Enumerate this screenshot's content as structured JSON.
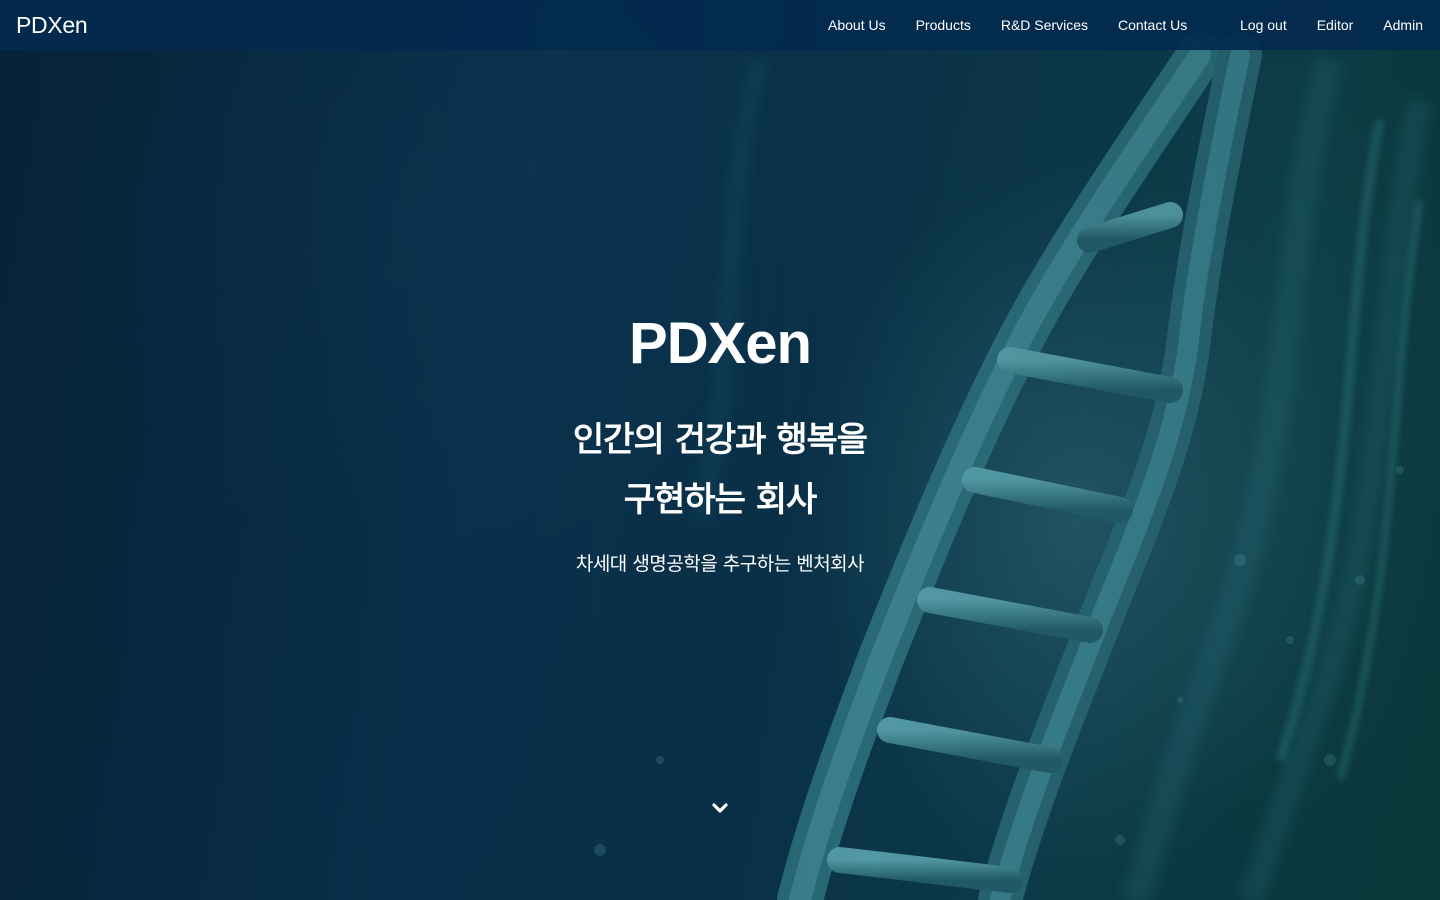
{
  "navbar": {
    "brand": "PDXen",
    "main_links": [
      {
        "label": "About Us"
      },
      {
        "label": "Products"
      },
      {
        "label": "R&D Services"
      },
      {
        "label": "Contact Us"
      }
    ],
    "right_links": [
      {
        "label": "Log out"
      },
      {
        "label": "Editor"
      },
      {
        "label": "Admin"
      }
    ]
  },
  "hero": {
    "title": "PDXen",
    "heading_line1": "인간의 건강과 행복을",
    "heading_line2": "구현하는 회사",
    "subheading": "차세대 생명공학을 추구하는 벤처회사",
    "scroll_icon": "chevron-down-icon"
  },
  "colors": {
    "navbar_bg": "#032a4e",
    "hero_bg": "#0a3350",
    "text": "#ffffff",
    "dna_accent": "#3f8a99"
  }
}
